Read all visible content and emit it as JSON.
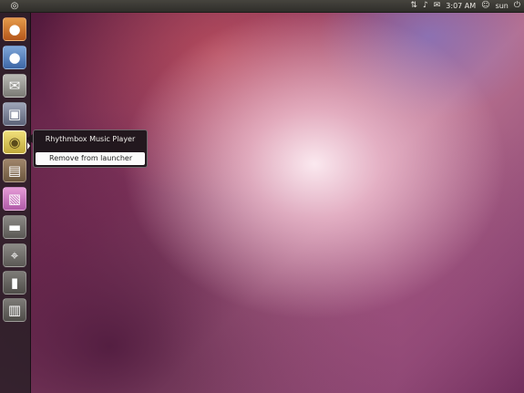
{
  "top_panel": {
    "bfb_icon": "ubuntu-logo-icon",
    "tray_icons": [
      "network-icon",
      "volume-icon",
      "mail-icon"
    ],
    "clock": "3:07 AM",
    "user_icon": "user-icon",
    "user": "sun",
    "power_icon": "power-icon"
  },
  "launcher": {
    "items": [
      {
        "name": "firefox",
        "icon": "firefox-icon"
      },
      {
        "name": "empathy",
        "icon": "chat-bubbles-icon"
      },
      {
        "name": "mail",
        "icon": "envelope-icon"
      },
      {
        "name": "shotwell",
        "icon": "photo-viewer-icon"
      },
      {
        "name": "rhythmbox",
        "icon": "speaker-icon"
      },
      {
        "name": "software-center",
        "icon": "shopping-bag-icon"
      },
      {
        "name": "workspace-switcher",
        "icon": "workspace-icon"
      },
      {
        "name": "files",
        "icon": "folder-icon"
      },
      {
        "name": "applications",
        "icon": "apps-icon"
      },
      {
        "name": "usb-drive",
        "icon": "usb-icon"
      },
      {
        "name": "trash",
        "icon": "trash-icon"
      }
    ]
  },
  "quicklist": {
    "title": "Rhythmbox Music Player",
    "items": [
      "Remove from launcher"
    ]
  }
}
